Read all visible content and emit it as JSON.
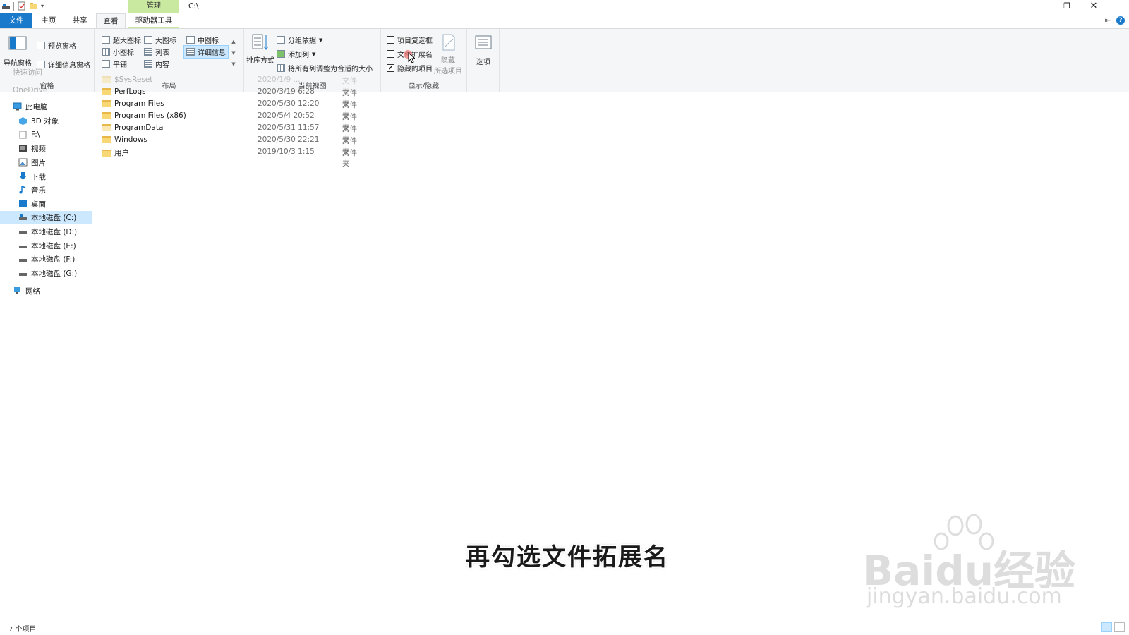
{
  "title_bar": {
    "context_tab_group": "管理",
    "path": "C:\\",
    "minimize": "—",
    "restore": "❐",
    "close": "✕"
  },
  "tabs": [
    {
      "label": "文件"
    },
    {
      "label": "主页"
    },
    {
      "label": "共享"
    },
    {
      "label": "查看"
    },
    {
      "label": "驱动器工具"
    }
  ],
  "ribbon": {
    "panes": {
      "label": "窗格",
      "nav_pane": "导航窗格",
      "preview_pane": "预览窗格",
      "details_pane": "详细信息窗格"
    },
    "layout": {
      "label": "布局",
      "extra_large": "超大图标",
      "large": "大图标",
      "medium": "中图标",
      "small": "小图标",
      "list": "列表",
      "details": "详细信息",
      "tiles": "平铺",
      "content": "内容",
      "selected": "详细信息"
    },
    "current_view": {
      "label": "当前视图",
      "sort_by": "排序方式",
      "group_by": "分组依据",
      "add_columns": "添加列",
      "size_all_columns": "将所有列调整为合适的大小"
    },
    "show_hide": {
      "label": "显示/隐藏",
      "item_checkboxes": {
        "label": "项目复选框",
        "checked": false
      },
      "file_extensions": {
        "label": "文件扩展名",
        "checked": false
      },
      "hidden_items": {
        "label": "隐藏的项目",
        "checked": true
      },
      "hide_selected": "隐藏",
      "hide_selected_sub": "所选项目"
    },
    "options": "选项"
  },
  "nav": {
    "faded_top": [
      "快速访问",
      "OneDrive"
    ],
    "this_pc": "此电脑",
    "items": [
      {
        "label": "3D 对象",
        "icon": "3d-objects-icon"
      },
      {
        "label": "F:\\",
        "icon": "drive-icon"
      },
      {
        "label": "视频",
        "icon": "video-icon"
      },
      {
        "label": "图片",
        "icon": "pictures-icon"
      },
      {
        "label": "下载",
        "icon": "download-icon"
      },
      {
        "label": "音乐",
        "icon": "music-icon"
      },
      {
        "label": "桌面",
        "icon": "desktop-icon"
      },
      {
        "label": "本地磁盘 (C:)",
        "icon": "disk-icon",
        "selected": true
      },
      {
        "label": "本地磁盘 (D:)",
        "icon": "disk-icon"
      },
      {
        "label": "本地磁盘 (E:)",
        "icon": "disk-icon"
      },
      {
        "label": "本地磁盘 (F:)",
        "icon": "disk-icon"
      },
      {
        "label": "本地磁盘 (G:)",
        "icon": "disk-icon"
      }
    ],
    "network": "网络"
  },
  "files": [
    {
      "name": "$SysReset",
      "date": "2020/1/9 ...",
      "type": "文件夹",
      "faded": true
    },
    {
      "name": "PerfLogs",
      "date": "2020/3/19 6:28",
      "type": "文件夹"
    },
    {
      "name": "Program Files",
      "date": "2020/5/30 12:20",
      "type": "文件夹"
    },
    {
      "name": "Program Files (x86)",
      "date": "2020/5/4 20:52",
      "type": "文件夹"
    },
    {
      "name": "ProgramData",
      "date": "2020/5/31 11:57",
      "type": "文件夹"
    },
    {
      "name": "Windows",
      "date": "2020/5/30 22:21",
      "type": "文件夹"
    },
    {
      "name": "用户",
      "date": "2019/10/3 1:15",
      "type": "文件夹"
    }
  ],
  "status": {
    "item_count": "7 个项目"
  },
  "overlay": {
    "caption": "再勾选文件拓展名",
    "watermark_main": "Baidu经验",
    "watermark_url": "jingyan.baidu.com"
  },
  "colors": {
    "file_tab": "#1979ca",
    "manage_tab": "#c9e8a0",
    "selection": "#cce8ff"
  }
}
